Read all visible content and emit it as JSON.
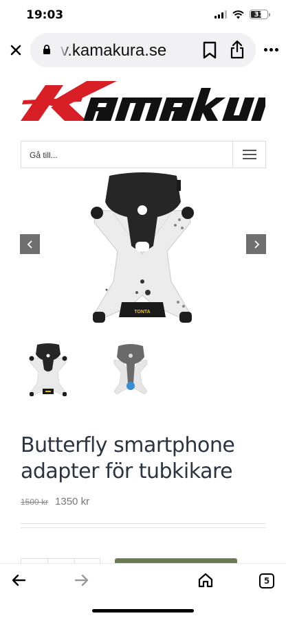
{
  "status_bar": {
    "time": "19:03",
    "battery": "31",
    "battery_level_pct": 31,
    "icons": [
      "cellular-signal-icon",
      "wifi-icon",
      "battery-icon"
    ]
  },
  "browser": {
    "url_display": "v.kamakura.se",
    "icons": [
      "close-icon",
      "lock-icon",
      "bookmark-icon",
      "share-icon",
      "more-icon"
    ]
  },
  "site": {
    "logo_text": "Kamakura",
    "brand_color": "#d81f26"
  },
  "nav": {
    "goto_label": "Gå till...",
    "menu_icon": "hamburger-menu-icon"
  },
  "gallery": {
    "prev_icon": "chevron-left-icon",
    "next_icon": "chevron-right-icon",
    "badge_text": "TONTA",
    "thumbnails": [
      "thumbnail-black-adapter",
      "thumbnail-gray-adapter"
    ]
  },
  "product": {
    "title": "Butterfly smartphone adapter för tubkikare",
    "price_old": "1500 kr",
    "price_new": "1350 kr",
    "accent_color": "#6b7c50"
  },
  "toolbar": {
    "tabs_count": "5",
    "icons": [
      "back-arrow-icon",
      "forward-arrow-icon",
      "home-icon",
      "tabs-icon"
    ]
  }
}
